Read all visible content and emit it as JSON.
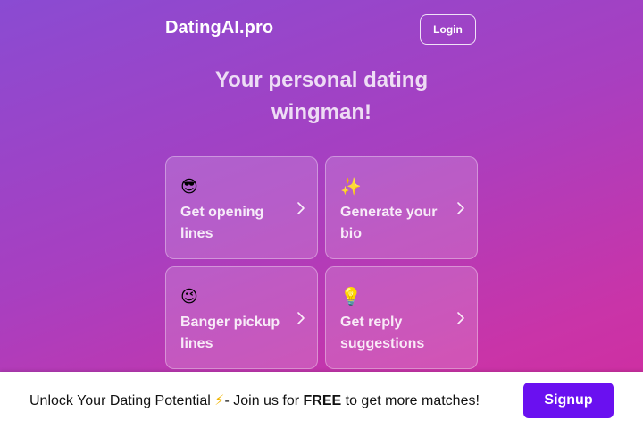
{
  "header": {
    "brand": "DatingAI.pro",
    "login_label": "Login"
  },
  "hero": {
    "title_line1": "Your personal dating",
    "title_line2": "wingman!"
  },
  "features": [
    {
      "emoji": "😎",
      "label": "Get opening lines",
      "icon": "sunglasses-emoji-icon"
    },
    {
      "emoji": "✨",
      "label": "Generate your bio",
      "icon": "sparkles-emoji-icon"
    },
    {
      "emoji": "😉",
      "label": "Banger pickup lines",
      "icon": "wink-emoji-icon"
    },
    {
      "emoji": "💡",
      "label": "Get reply suggestions",
      "icon": "lightbulb-emoji-icon"
    }
  ],
  "footer": {
    "text_before": "Unlock Your Dating Potential ",
    "bolt": "⚡",
    "text_middle": "- Join us for ",
    "text_bold": "FREE",
    "text_after": " to get more matches!",
    "signup_label": "Signup"
  },
  "colors": {
    "gradient_start": "#8a4bd2",
    "gradient_end": "#d12c9e",
    "signup_button": "#6a10f0",
    "footer_background": "#ffffff"
  }
}
